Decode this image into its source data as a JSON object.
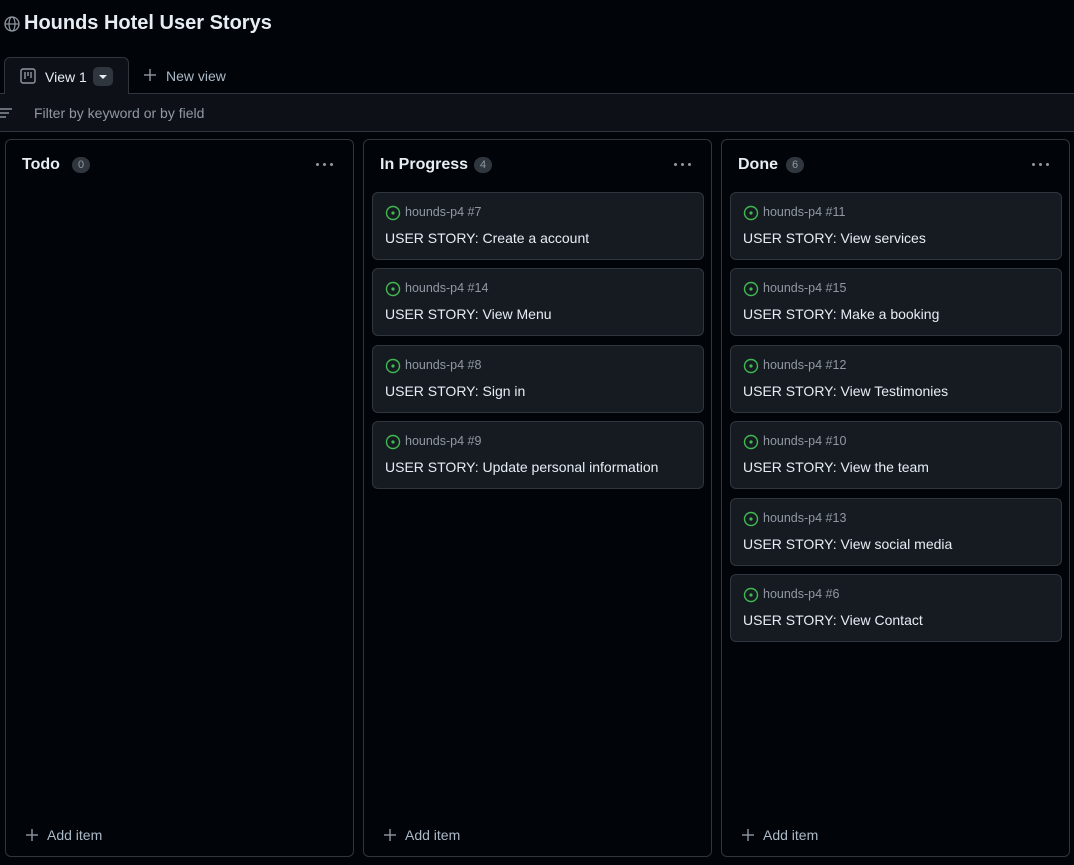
{
  "project": {
    "title": "Hounds Hotel User Storys"
  },
  "tabs": {
    "active_label": "View 1",
    "new_view_label": "New view"
  },
  "filter": {
    "placeholder": "Filter by keyword or by field"
  },
  "colors": {
    "background": "#010409",
    "card": "#161b22",
    "border": "#30363d",
    "open_issue": "#3fb950",
    "muted": "#9198a1"
  },
  "columns": [
    {
      "title": "Todo",
      "count": "0",
      "add_label": "Add item",
      "cards": []
    },
    {
      "title": "In Progress",
      "count": "4",
      "add_label": "Add item",
      "cards": [
        {
          "ref": "hounds-p4 #7",
          "title": "USER STORY: Create a account"
        },
        {
          "ref": "hounds-p4 #14",
          "title": "USER STORY: View Menu"
        },
        {
          "ref": "hounds-p4 #8",
          "title": "USER STORY: Sign in"
        },
        {
          "ref": "hounds-p4 #9",
          "title": "USER STORY: Update personal information"
        }
      ]
    },
    {
      "title": "Done",
      "count": "6",
      "add_label": "Add item",
      "cards": [
        {
          "ref": "hounds-p4 #11",
          "title": "USER STORY: View services"
        },
        {
          "ref": "hounds-p4 #15",
          "title": "USER STORY: Make a booking"
        },
        {
          "ref": "hounds-p4 #12",
          "title": "USER STORY: View Testimonies"
        },
        {
          "ref": "hounds-p4 #10",
          "title": "USER STORY: View the team"
        },
        {
          "ref": "hounds-p4 #13",
          "title": "USER STORY: View social media"
        },
        {
          "ref": "hounds-p4 #6",
          "title": "USER STORY: View Contact"
        }
      ]
    }
  ]
}
